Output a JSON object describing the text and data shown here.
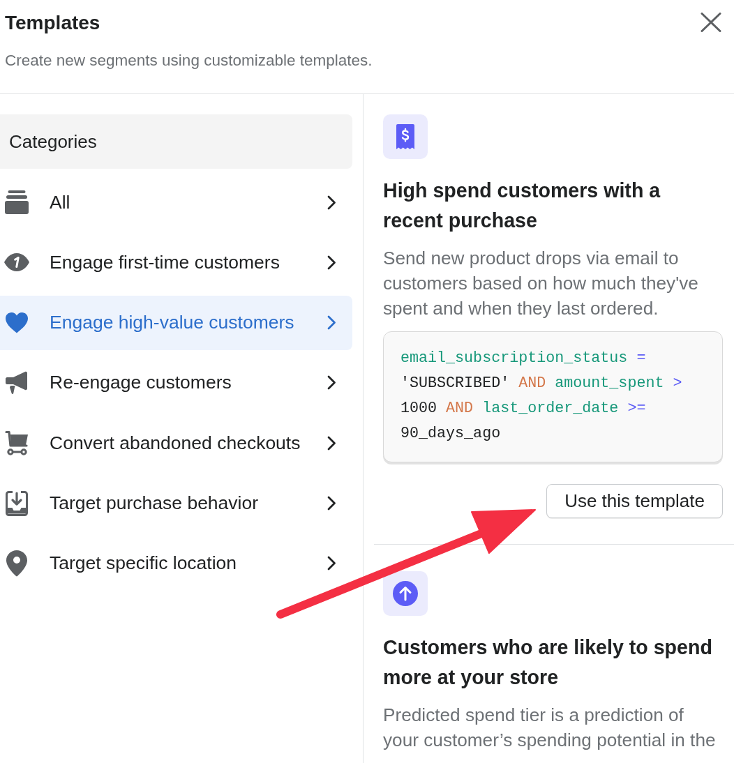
{
  "header": {
    "title": "Templates",
    "subtitle": "Create new segments using customizable templates."
  },
  "sidebar": {
    "heading": "Categories",
    "items": [
      {
        "label": "All",
        "selected": false
      },
      {
        "label": "Engage first-time customers",
        "selected": false
      },
      {
        "label": "Engage high-value customers",
        "selected": true
      },
      {
        "label": "Re-engage customers",
        "selected": false
      },
      {
        "label": "Convert abandoned checkouts",
        "selected": false
      },
      {
        "label": "Target purchase behavior",
        "selected": false
      },
      {
        "label": "Target specific location",
        "selected": false
      }
    ]
  },
  "templates": [
    {
      "title": "High spend customers with a recent purchase",
      "description": "Send new product drops via email to customers based on how much they've spent and when they last ordered.",
      "query": [
        {
          "text": "email_subscription_status",
          "kind": "field"
        },
        {
          "text": "=",
          "kind": "operator"
        },
        {
          "text": "'SUBSCRIBED'",
          "kind": "value"
        },
        {
          "text": "AND",
          "kind": "keyword"
        },
        {
          "text": "amount_spent",
          "kind": "field"
        },
        {
          "text": ">",
          "kind": "operator"
        },
        {
          "text": "1000",
          "kind": "value"
        },
        {
          "text": "AND",
          "kind": "keyword"
        },
        {
          "text": "last_order_date",
          "kind": "field"
        },
        {
          "text": ">=",
          "kind": "operator"
        },
        {
          "text": "90_days_ago",
          "kind": "value"
        }
      ],
      "button": "Use this template"
    },
    {
      "title": "Customers who are likely to spend more at your store",
      "description": "Predicted spend tier is a prediction of your customer’s spending potential in the"
    }
  ],
  "overlay": [
    {
      "kind": "arrow"
    }
  ]
}
